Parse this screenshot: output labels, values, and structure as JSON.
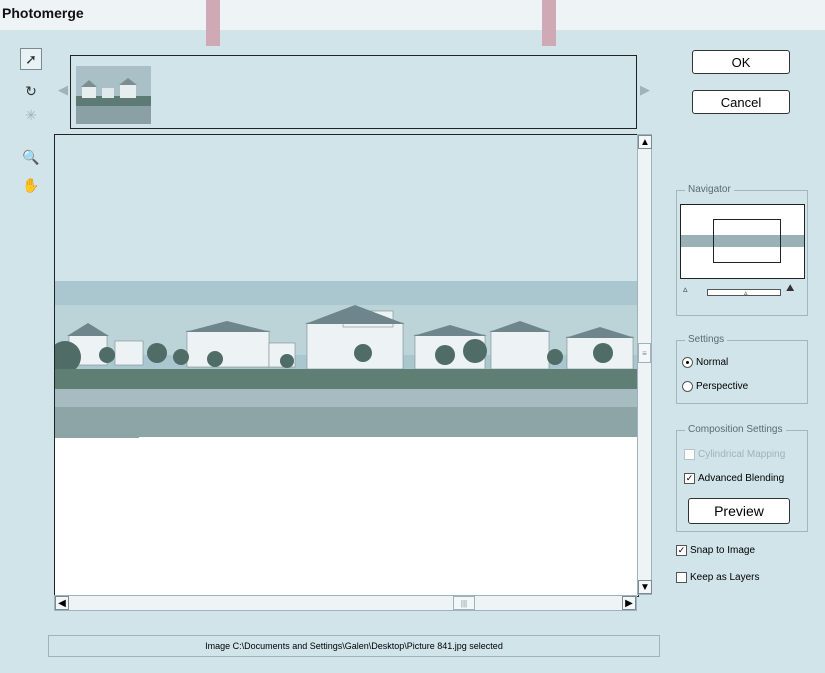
{
  "window": {
    "title": "Photomerge"
  },
  "tools": [
    {
      "icon": "select-arrow-icon",
      "glyph": "➚"
    },
    {
      "icon": "rotate-icon",
      "glyph": "↻"
    },
    {
      "icon": "vanishing-point-icon",
      "glyph": "✳"
    },
    {
      "icon": "zoom-icon",
      "glyph": "🔍"
    },
    {
      "icon": "hand-icon",
      "glyph": "✋"
    }
  ],
  "lightbox": {
    "left_arrow": "◀",
    "right_arrow": "▶"
  },
  "buttons": {
    "ok": "OK",
    "cancel": "Cancel",
    "preview": "Preview"
  },
  "navigator": {
    "label": "Navigator",
    "zoom_out": "▵",
    "zoom_in": "⛰"
  },
  "settings": {
    "label": "Settings",
    "normal": "Normal",
    "perspective": "Perspective",
    "selected": "Normal"
  },
  "composition": {
    "label": "Composition Settings",
    "cylindrical": "Cylindrical Mapping",
    "advanced": "Advanced Blending",
    "cylindrical_checked": false,
    "advanced_checked": true
  },
  "snap_to_image": {
    "label": "Snap to Image",
    "checked": true
  },
  "keep_as_layers": {
    "label": "Keep as Layers",
    "checked": false
  },
  "status": "Image C:\\Documents and Settings\\Galen\\Desktop\\Picture 841.jpg selected",
  "scroll": {
    "up": "▲",
    "down": "▼",
    "left": "◀",
    "right": "▶",
    "grip_v": "≡",
    "grip_h": "|||"
  },
  "check_mark": "✓"
}
